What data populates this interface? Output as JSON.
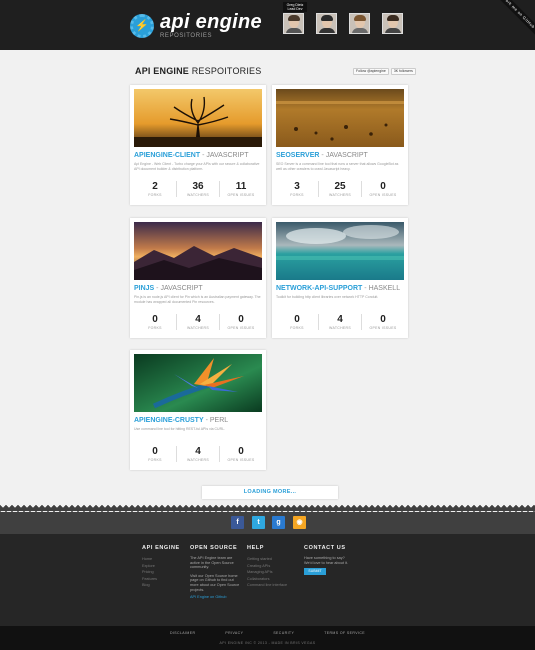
{
  "header": {
    "logo_title": "api engine",
    "logo_sub": "REPOSITORIES",
    "tooltip": "Greg Dietz  Lead Dev",
    "ribbon": "Fork me on GitHub"
  },
  "main": {
    "title_bold": "API ENGINE",
    "title_rest": " RESPOITORIES",
    "follow_label": "Follow @apiengine",
    "followers_label": "3K followers",
    "loading_label": "LOADING MORE...",
    "stat_labels": {
      "forks": "FORKS",
      "watchers": "WATCHERS",
      "issues": "OPEN ISSUES"
    },
    "repos": [
      {
        "name": "APIENGINE-CLIENT",
        "sep": " - ",
        "lang": "JAVASCRIPT",
        "desc": "Api Engine - Web Client - Turbo charge your APIs with our secure & collaborative API document builder & distribution platform.",
        "forks": "2",
        "watchers": "36",
        "issues": "11"
      },
      {
        "name": "SEOSERVER",
        "sep": " - ",
        "lang": "JAVASCRIPT",
        "desc": "SEO Server is a command line tool that runs a server that allows GoogleBot as well as other crawlers to crawl Javascript heavy.",
        "forks": "3",
        "watchers": "25",
        "issues": "0"
      },
      {
        "name": "PINJS",
        "sep": " - ",
        "lang": "JAVASCRIPT",
        "desc": "Pin.js is an node.js API client for Pin which is an Australian payment gateway. The module has wrapped all documented Pin resources.",
        "forks": "0",
        "watchers": "4",
        "issues": "0"
      },
      {
        "name": "NETWORK-API-SUPPORT",
        "sep": " - ",
        "lang": "HASKELL",
        "desc": "Toolkit for building http client libraries over network HTTP Conduit.",
        "forks": "0",
        "watchers": "4",
        "issues": "0"
      },
      {
        "name": "APIENGINE-CRUSTY",
        "sep": " - ",
        "lang": "PERL",
        "desc": "Use command line tool for hitting REST-ful APIs via CURL.",
        "forks": "0",
        "watchers": "4",
        "issues": "0"
      }
    ]
  },
  "footer": {
    "col1": {
      "title": "API ENGINE",
      "links": [
        "Home",
        "Explore",
        "Pricing",
        "Features",
        "Blog"
      ]
    },
    "col2": {
      "title": "OPEN SOURCE",
      "text1": "The API Engine team are active in the Open Source community.",
      "text2": "Visit our Open Source home page on Github to find out more about our Open Source projects.",
      "link": "API Engine on Github"
    },
    "col3": {
      "title": "HELP",
      "links": [
        "Getting started",
        "Creating APIs",
        "Managing APIs",
        "Collaborators",
        "Command line interface"
      ]
    },
    "col4": {
      "title": "CONTACT US",
      "text": "Have something to say? We'd love to hear about it.",
      "submit": "SUBMIT"
    },
    "bottom_links": [
      "DISCLAIMER",
      "PRIVACY",
      "SECURITY",
      "TERMS OF SERVICE"
    ],
    "copyright": "API ENGINE INC © 2013 - MADE IN BRIS VEGAS"
  },
  "colors": {
    "accent": "#2a9fd8",
    "facebook": "#3b5998",
    "twitter": "#2fa8e0",
    "googleplus": "#2a7ad0",
    "rss": "#f5a623"
  }
}
